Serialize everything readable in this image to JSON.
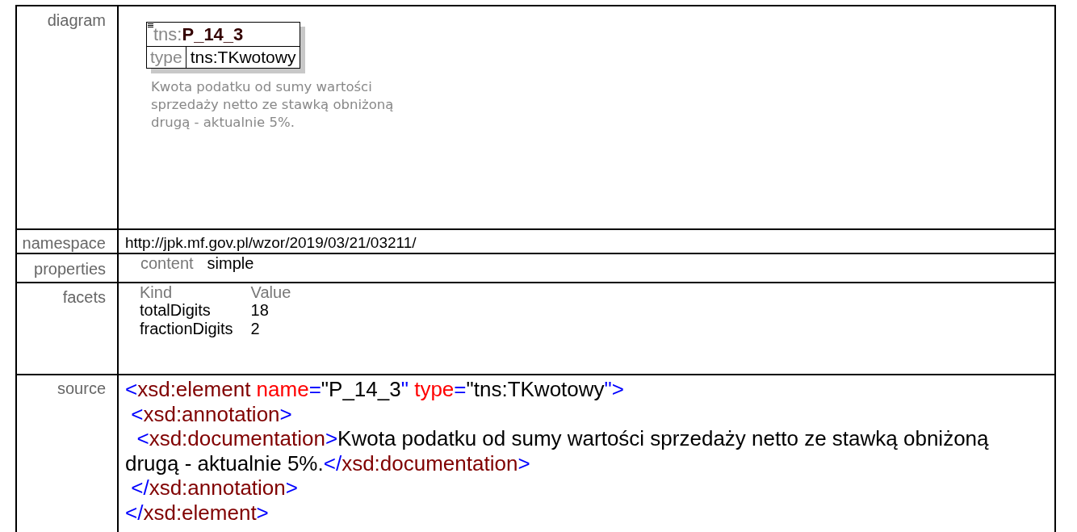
{
  "rows": [
    {
      "label": "diagram",
      "kind": "diagram",
      "diagram": {
        "prefix": "tns:",
        "name": "P_14_3",
        "attribute": {
          "label": "type",
          "value": "tns:TKwotowy"
        },
        "documentation": "Kwota podatku od sumy wartości sprzedaży netto ze stawką obniżoną drugą - aktualnie 5%."
      }
    },
    {
      "label": "namespace",
      "kind": "text",
      "text": "http://jpk.mf.gov.pl/wzor/2019/03/21/03211/"
    },
    {
      "label": "properties",
      "kind": "properties",
      "items": [
        {
          "key": "content",
          "value": "simple"
        }
      ]
    },
    {
      "label": "facets",
      "kind": "facets",
      "columns": [
        "Kind",
        "Value"
      ],
      "items": [
        {
          "name": "totalDigits",
          "value": "18"
        },
        {
          "name": "fractionDigits",
          "value": "2"
        }
      ]
    },
    {
      "label": "source",
      "kind": "source",
      "lines": [
        [
          {
            "kind": "punct",
            "s": "<"
          },
          {
            "kind": "tag",
            "s": "xsd:element"
          },
          {
            "kind": "attr",
            "s": " name"
          },
          {
            "kind": "punct",
            "s": "="
          },
          {
            "kind": "text",
            "s": "\"P_14_3"
          },
          {
            "kind": "punct",
            "s": "\""
          },
          {
            "kind": "attr",
            "s": " type"
          },
          {
            "kind": "punct",
            "s": "="
          },
          {
            "kind": "text",
            "s": "\"tns:TKwotowy"
          },
          {
            "kind": "punct",
            "s": "\">"
          }
        ],
        [
          {
            "kind": "punct",
            "s": " <"
          },
          {
            "kind": "tag",
            "s": "xsd:annotation"
          },
          {
            "kind": "punct",
            "s": ">"
          }
        ],
        [
          {
            "kind": "punct",
            "s": "  <"
          },
          {
            "kind": "tag",
            "s": "xsd:documentation"
          },
          {
            "kind": "punct",
            "s": ">"
          },
          {
            "kind": "text",
            "s": "Kwota podatku od sumy wartości sprzedaży netto ze stawką obniżoną drugą - aktualnie 5%."
          },
          {
            "kind": "punct",
            "s": "</"
          },
          {
            "kind": "tag",
            "s": "xsd:documentation"
          },
          {
            "kind": "punct",
            "s": ">"
          }
        ],
        [
          {
            "kind": "punct",
            "s": " </"
          },
          {
            "kind": "tag",
            "s": "xsd:annotation"
          },
          {
            "kind": "punct",
            "s": ">"
          }
        ],
        [
          {
            "kind": "punct",
            "s": "</"
          },
          {
            "kind": "tag",
            "s": "xsd:element"
          },
          {
            "kind": "punct",
            "s": ">"
          }
        ]
      ]
    }
  ]
}
